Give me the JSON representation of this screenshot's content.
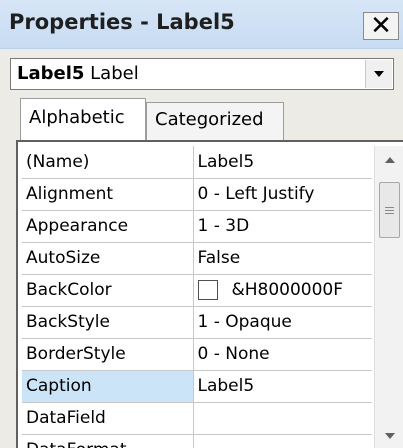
{
  "window": {
    "title": "Properties - Label5",
    "close_glyph": "✕"
  },
  "object_selector": {
    "name": "Label5",
    "type": "Label"
  },
  "tabs": [
    {
      "label": "Alphabetic",
      "active": true
    },
    {
      "label": "Categorized",
      "active": false
    }
  ],
  "properties": [
    {
      "name": "(Name)",
      "value": "Label5"
    },
    {
      "name": "Alignment",
      "value": "0 - Left Justify"
    },
    {
      "name": "Appearance",
      "value": "1 - 3D"
    },
    {
      "name": "AutoSize",
      "value": "False"
    },
    {
      "name": "BackColor",
      "value": "&H8000000F",
      "swatch_color": "#ffffff"
    },
    {
      "name": "BackStyle",
      "value": "1 - Opaque"
    },
    {
      "name": "BorderStyle",
      "value": "0 - None"
    },
    {
      "name": "Caption",
      "value": "Label5",
      "selected": true
    },
    {
      "name": "DataField",
      "value": ""
    },
    {
      "name": "DataFormat",
      "value": ""
    }
  ],
  "colors": {
    "titlebar": "#c7dbf2",
    "selected_row": "#cce4f7"
  }
}
